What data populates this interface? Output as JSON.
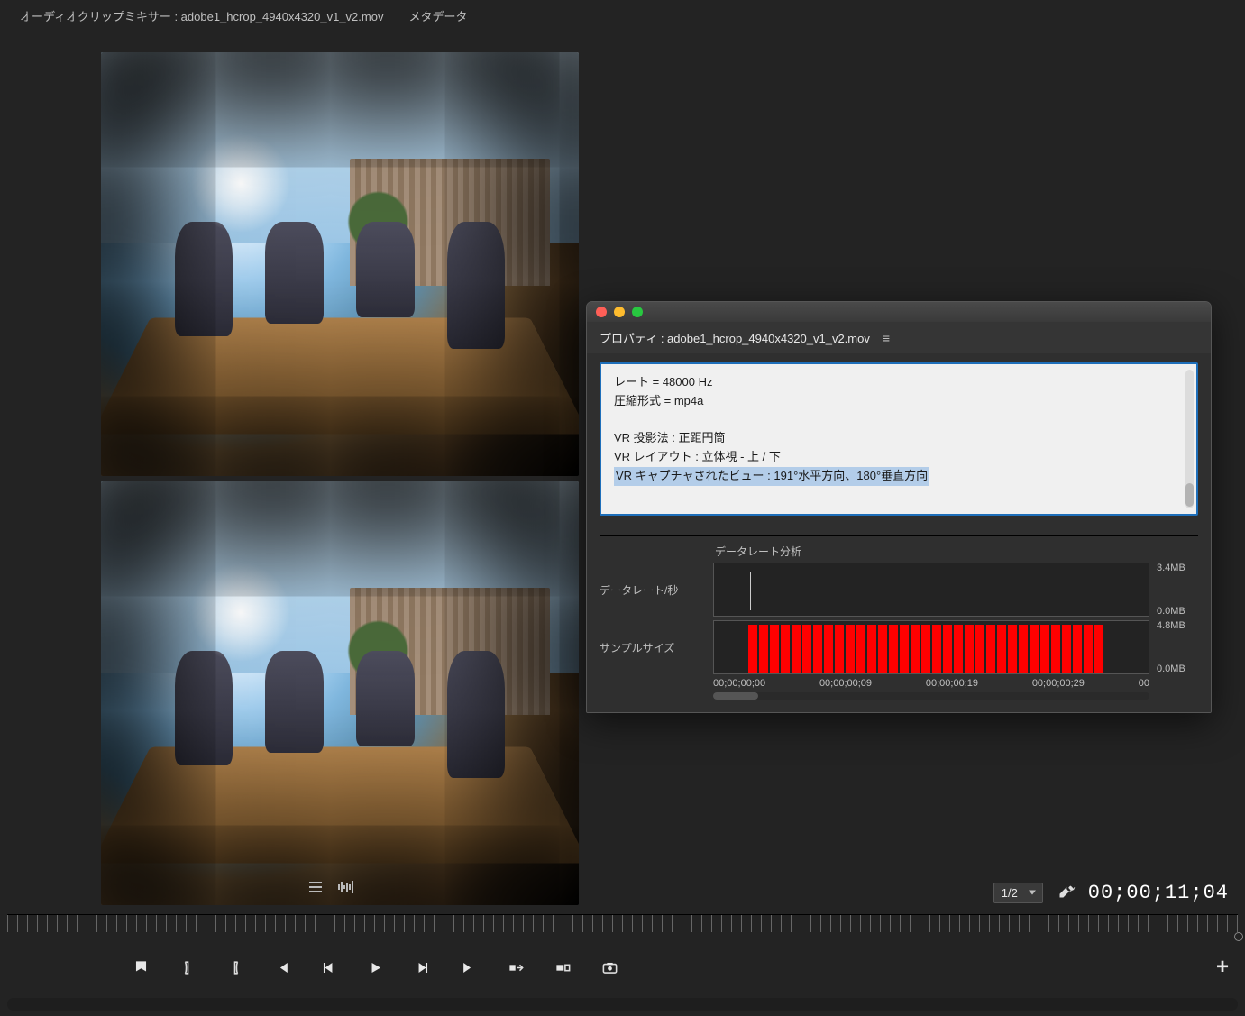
{
  "tabs": {
    "audio_mixer": "オーディオクリップミキサー : adobe1_hcrop_4940x4320_v1_v2.mov",
    "metadata": "メタデータ"
  },
  "properties_window": {
    "title": "プロパティ : adobe1_hcrop_4940x4320_v1_v2.mov",
    "lines": {
      "rate": "レート = 48000 Hz",
      "compression": "圧縮形式 = mp4a",
      "vr_projection": "VR 投影法 : 正距円筒",
      "vr_layout": "VR レイアウト : 立体視 - 上 / 下",
      "vr_captured_view": "VR キャプチャされたビュー : 191°水平方向、180°垂直方向"
    },
    "analysis": {
      "title": "データレート分析",
      "data_rate_label": "データレート/秒",
      "sample_size_label": "サンプルサイズ",
      "rate_scale_top": "3.4MB",
      "rate_scale_bottom": "0.0MB",
      "sample_scale_top": "4.8MB",
      "sample_scale_bottom": "0.0MB",
      "time_axis": {
        "t0": "00;00;00;00",
        "t1": "00;00;00;09",
        "t2": "00;00;00;19",
        "t3": "00;00;00;29",
        "t4": "00"
      }
    }
  },
  "footer": {
    "zoom": "1/2",
    "timecode": "00;00;11;04"
  }
}
